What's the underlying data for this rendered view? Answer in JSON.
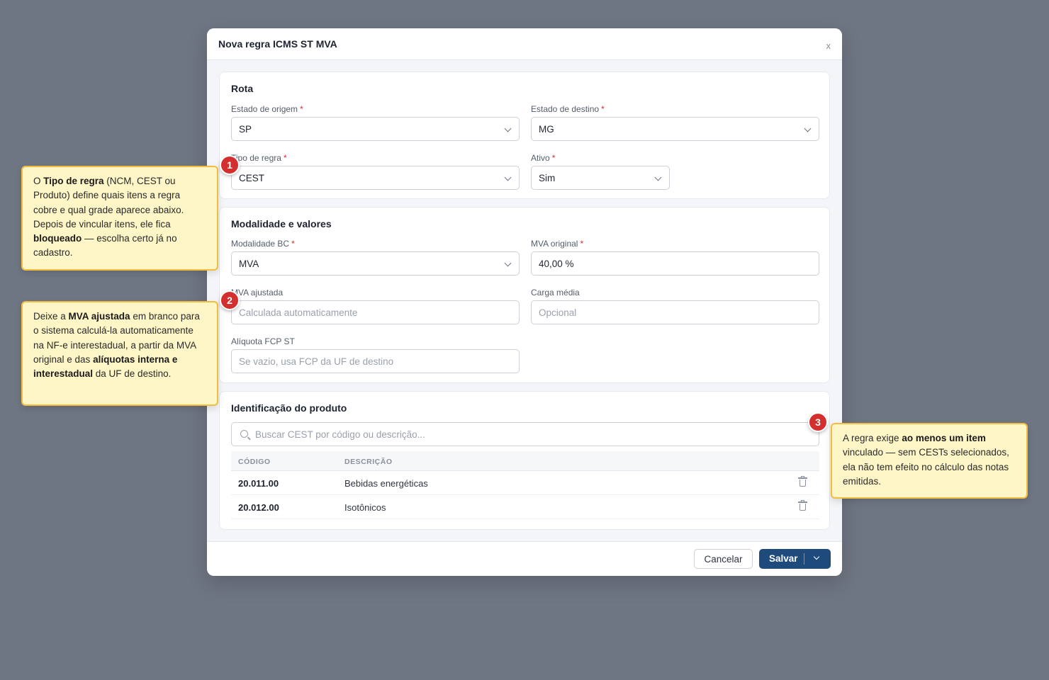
{
  "modal": {
    "title": "Nova regra ICMS ST MVA",
    "close_label": "x"
  },
  "rota": {
    "title": "Rota",
    "origem": {
      "label": "Estado de origem",
      "value": "SP"
    },
    "destino": {
      "label": "Estado de destino",
      "value": "MG"
    },
    "tipo": {
      "label": "Tipo de regra",
      "value": "CEST"
    },
    "ativo": {
      "label": "Ativo",
      "value": "Sim"
    }
  },
  "modalidade": {
    "title": "Modalidade e valores",
    "modalidade_bc": {
      "label": "Modalidade BC",
      "value": "MVA"
    },
    "mva_original": {
      "label": "MVA original",
      "value": "40,00 %"
    },
    "mva_ajustada": {
      "label": "MVA ajustada",
      "placeholder": "Calculada automaticamente"
    },
    "carga_media": {
      "label": "Carga média",
      "placeholder": "Opcional"
    },
    "aliquota_fcp": {
      "label": "Alíquota FCP ST",
      "placeholder": "Se vazio, usa FCP da UF de destino"
    }
  },
  "produto": {
    "title": "Identificação do produto",
    "search_placeholder": "Buscar CEST por código ou descrição...",
    "columns": [
      "CÓDIGO",
      "DESCRIÇÃO"
    ],
    "rows": [
      {
        "code": "20.011.00",
        "description": "Bebidas energéticas"
      },
      {
        "code": "20.012.00",
        "description": "Isotônicos"
      }
    ]
  },
  "footer": {
    "cancel_label": "Cancelar",
    "save_label": "Salvar"
  },
  "required_marker": "*",
  "badges": [
    "1",
    "2",
    "3"
  ],
  "callouts": {
    "c1": {
      "t1": "O ",
      "b1": "Tipo de regra",
      "t2": " (NCM, CEST ou Produto) define quais itens a regra cobre e qual grade aparece abaixo. Depois de vincular itens, ele fica ",
      "b2": "bloqueado",
      "t3": " — escolha certo já no cadastro."
    },
    "c2": {
      "t1": "Deixe a ",
      "b1": "MVA ajustada",
      "t2": " em branco para o sistema calculá-la automaticamente na NF-e interestadual, a partir da MVA original e das ",
      "b2": "alíquotas interna e interestadual",
      "t3": " da UF de destino."
    },
    "c3": {
      "t1": "A regra exige ",
      "b1": "ao menos um item",
      "t2": " vinculado — sem CESTs selecionados, ela não tem efeito no cálculo das notas emitidas."
    }
  },
  "colors": {
    "backdrop": "#6f7683",
    "primary": "#1e4a7c",
    "required": "#d32f2f",
    "callout_bg": "#fff6c7",
    "callout_border": "#f2bd3e",
    "badge": "#d32f2f"
  }
}
